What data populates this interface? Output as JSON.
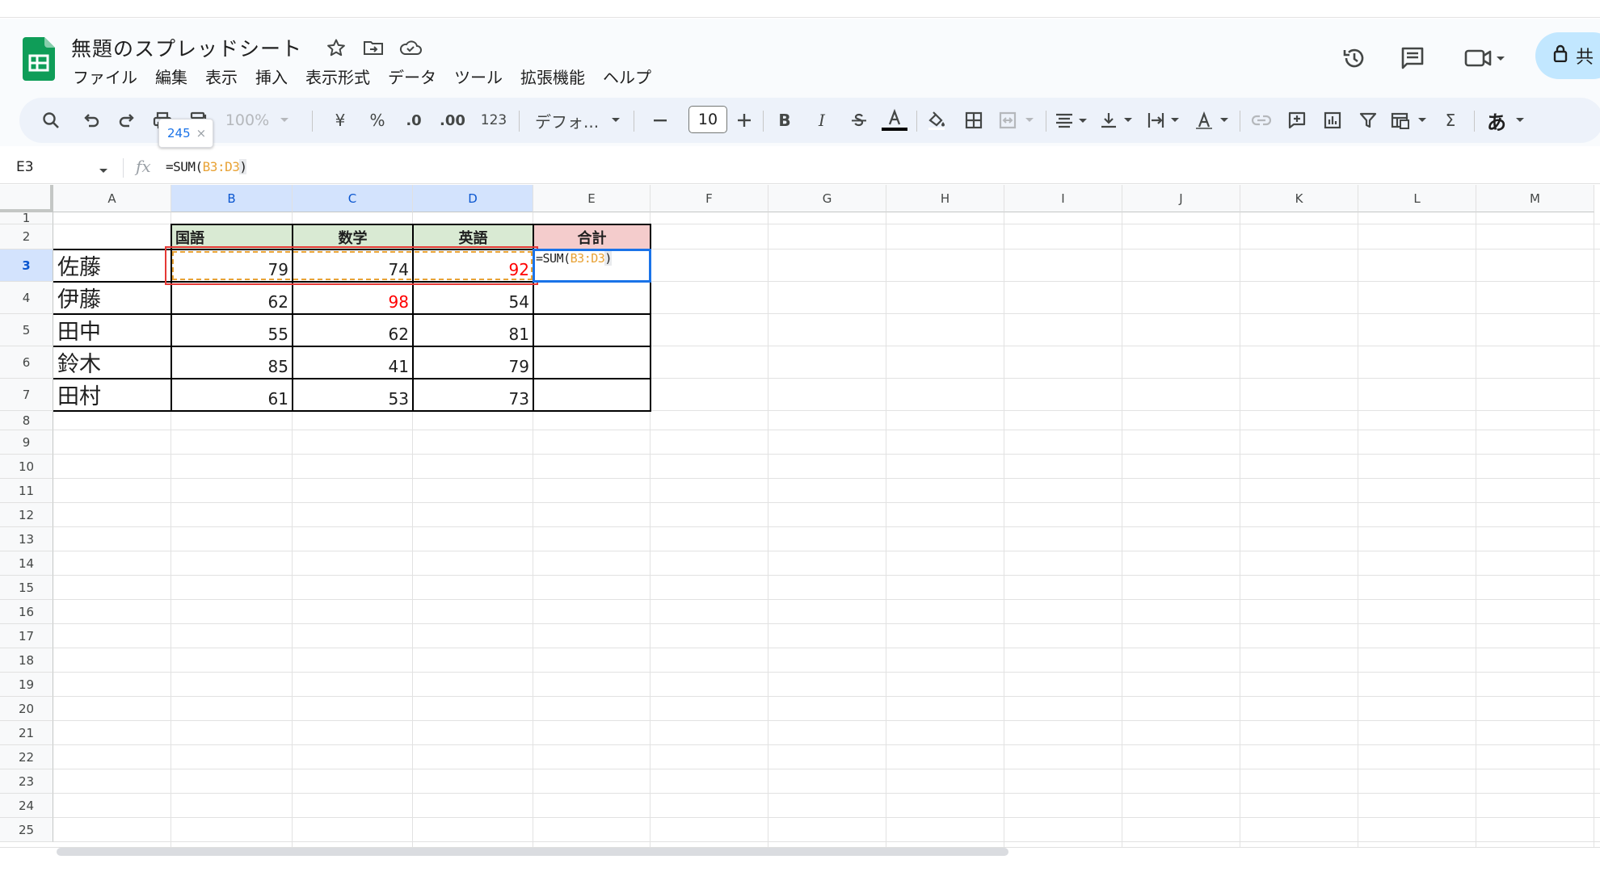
{
  "app": {
    "doc_title": "無題のスプレッドシート",
    "menu": [
      "ファイル",
      "編集",
      "表示",
      "挿入",
      "表示形式",
      "データ",
      "ツール",
      "拡張機能",
      "ヘルプ"
    ],
    "share_label": "共"
  },
  "toolbar": {
    "zoom": "100%",
    "currency": "¥",
    "percent": "%",
    "decimal_decrease": ".0",
    "decimal_increase": ".00",
    "number_format": "123",
    "font": "デフォ...",
    "font_size": "10",
    "bold": "B",
    "italic": "I",
    "sum_symbol": "Σ",
    "input_tools": "あ",
    "tooltip_value": "245",
    "tooltip_close": "×"
  },
  "formula_bar": {
    "cell_ref": "E3",
    "fx": "fx",
    "formula_prefix": "=SUM(",
    "formula_ref": "B3:D3",
    "formula_suffix": ")"
  },
  "grid": {
    "columns": [
      "A",
      "B",
      "C",
      "D",
      "E",
      "F",
      "G",
      "H",
      "I",
      "J",
      "K",
      "L",
      "M"
    ],
    "rows": [
      "1",
      "2",
      "3",
      "4",
      "5",
      "6",
      "7",
      "8",
      "9",
      "10",
      "11",
      "12",
      "13",
      "14",
      "15",
      "16",
      "17",
      "18",
      "19",
      "20",
      "21",
      "22",
      "23",
      "24",
      "25"
    ],
    "selected_columns": [
      "B",
      "C",
      "D"
    ],
    "selected_row": "3"
  },
  "table": {
    "headers": [
      "国語",
      "数学",
      "英語"
    ],
    "total_header": "合計",
    "rows": [
      {
        "name": "佐藤",
        "values": [
          "79",
          "74",
          "92"
        ],
        "red": [
          false,
          false,
          true
        ]
      },
      {
        "name": "伊藤",
        "values": [
          "62",
          "98",
          "54"
        ],
        "red": [
          false,
          true,
          false
        ]
      },
      {
        "name": "田中",
        "values": [
          "55",
          "62",
          "81"
        ],
        "red": [
          false,
          false,
          false
        ]
      },
      {
        "name": "鈴木",
        "values": [
          "85",
          "41",
          "79"
        ],
        "red": [
          false,
          false,
          false
        ]
      },
      {
        "name": "田村",
        "values": [
          "61",
          "53",
          "73"
        ],
        "red": [
          false,
          false,
          false
        ]
      }
    ],
    "active_cell_formula": {
      "prefix": "=SUM(",
      "ref": "B3:D3",
      "suffix": ")"
    }
  },
  "colors": {
    "header_green": "#d9ead3",
    "header_red": "#f4cccc",
    "high_score_red": "#ff0000",
    "selection_blue": "#1a73e8",
    "range_ref_orange": "#e8a235"
  }
}
